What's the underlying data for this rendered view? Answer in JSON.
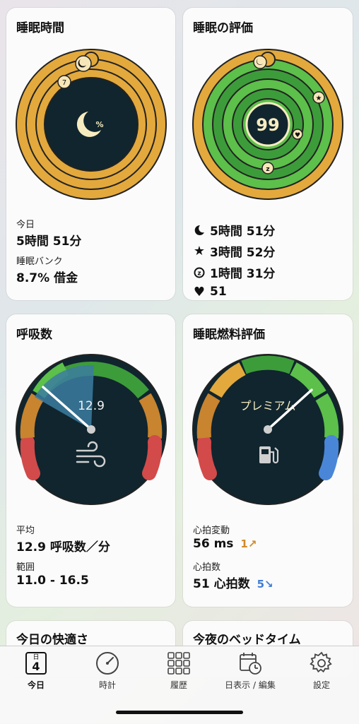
{
  "cards": {
    "sleep_time": {
      "title": "睡眠時間",
      "today_label": "今日",
      "today_value": "5時間 51分",
      "bank_label": "睡眠バンク",
      "bank_value": "8.7% 借金",
      "center_icon": "moon-percent-icon",
      "badge_number": "7"
    },
    "sleep_rating": {
      "title": "睡眠の評価",
      "score": "99",
      "rows": [
        {
          "icon": "moon-icon",
          "value": "5時間 51分"
        },
        {
          "icon": "star-icon",
          "value": "3時間 52分"
        },
        {
          "icon": "z-circle-icon",
          "value": "1時間 31分"
        },
        {
          "icon": "heart-icon",
          "value": "51"
        }
      ]
    },
    "breathing": {
      "title": "呼吸数",
      "dial_value": "12.9",
      "avg_label": "平均",
      "avg_value": "12.9 呼吸数／分",
      "range_label": "範囲",
      "range_value": "11.0 - 16.5"
    },
    "fuel": {
      "title": "睡眠燃料評価",
      "dial_text": "プレミアム",
      "hrv_label": "心拍変動",
      "hrv_value": "56 ms",
      "hrv_trend": "1↗",
      "hr_label": "心拍数",
      "hr_value": "51 心拍数",
      "hr_trend": "5↘"
    },
    "comfort": {
      "title": "今日の快適さ"
    },
    "bedtime": {
      "title": "今夜のベッドタイム"
    }
  },
  "tabbar": {
    "items": [
      {
        "label": "今日",
        "icon": "calendar-day-icon",
        "day": "4",
        "day_caption": "日"
      },
      {
        "label": "時計",
        "icon": "gauge-icon"
      },
      {
        "label": "履歴",
        "icon": "grid-icon"
      },
      {
        "label": "日表示 / 編集",
        "icon": "calendar-clock-icon"
      },
      {
        "label": "設定",
        "icon": "gear-icon"
      }
    ]
  },
  "colors": {
    "gold": "#E3A93C",
    "dark": "#10252e",
    "green_dark": "#3d9c3a",
    "green_light": "#5cc04a",
    "red": "#d24a4a",
    "orange": "#c8842e",
    "blue": "#4a86d8",
    "trend_orange": "#d08a2a",
    "trend_blue": "#3f7ed6"
  }
}
